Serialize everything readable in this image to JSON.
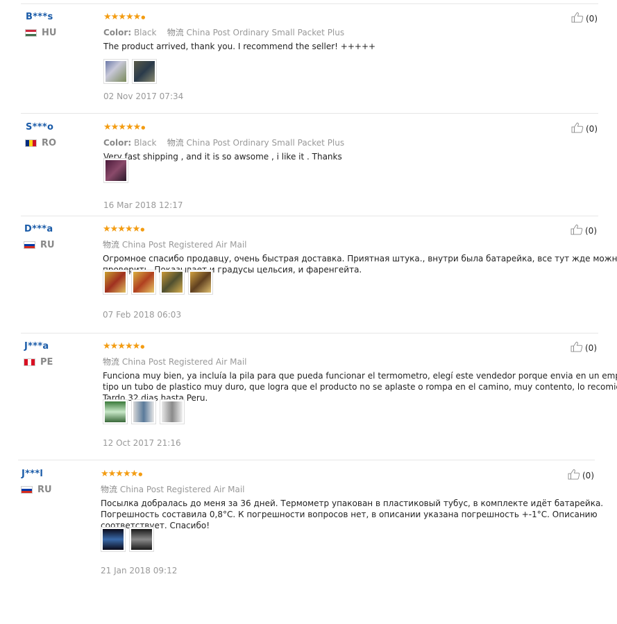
{
  "reviews": [
    {
      "name": "B***s",
      "country": "HU",
      "flag": [
        "#cd2a3e",
        "#ffffff",
        "#436f4d"
      ],
      "color_label": "Color:",
      "color_value": "Black",
      "shipping_label": "物流",
      "shipping_value": "China Post Ordinary Small Packet Plus",
      "text": [
        "The product arrived, thank you. I recommend the seller! +++++"
      ],
      "date": "02 Nov 2017 07:34",
      "likes": "(0)",
      "thumbs": [
        "linear-gradient(135deg,#6a78a8,#c8c8d8 40%,#7a8a5a)",
        "linear-gradient(135deg,#5a5a48,#2a3a4a 50%,#8a8a70)"
      ]
    },
    {
      "name": "S***o",
      "country": "RO",
      "flag": [
        "#002b7f",
        "#fcd116",
        "#ce1126"
      ],
      "color_label": "Color:",
      "color_value": "Black",
      "shipping_label": "物流",
      "shipping_value": "China Post Ordinary Small Packet Plus",
      "text": [
        "Very fast shipping , and it is so awsome , i like it . Thanks"
      ],
      "date": "16 Mar 2018 12:17",
      "likes": "(0)",
      "thumbs": [
        "linear-gradient(135deg,#4a1a3a,#8a4a6a 50%,#2a1a2a)"
      ]
    },
    {
      "name": "D***a",
      "country": "RU",
      "flag": [
        "#ffffff",
        "#0039a6",
        "#d52b1e"
      ],
      "color_label": "",
      "color_value": "",
      "shipping_label": "物流",
      "shipping_value": "China Post Registered Air Mail",
      "text": [
        "Огромное спасибо продавцу, очень быстрая доставка. Приятная штука., внутри была батарейка, все тут жде можно",
        "проверить. Показывает и градусы цельсия, и фаренгейта."
      ],
      "date": "07 Feb 2018 06:03",
      "likes": "(0)",
      "thumbs": [
        "linear-gradient(135deg,#c8a030,#a03020 50%,#e0c060)",
        "linear-gradient(135deg,#d8b040,#b04020 50%,#e8c868)",
        "linear-gradient(135deg,#c89838,#505030 50%,#d8b050)",
        "linear-gradient(135deg,#d0a040,#604020 50%,#e0c070)"
      ]
    },
    {
      "name": "J***a",
      "country": "PE",
      "flag": [
        "#d91023",
        "#ffffff",
        "#d91023"
      ],
      "color_label": "",
      "color_value": "",
      "shipping_label": "物流",
      "shipping_value": "China Post Registered Air Mail",
      "text": [
        "Funciona muy bien, ya incluía la pila para que pueda funcionar el termometro, elegí este vendedor porque envia en un empaque",
        "tipo un tubo de plastico muy duro, que logra que el producto no se aplaste o rompa en el camino, muy contento, lo recomiendo.",
        "Tardo 32 dias hasta Peru."
      ],
      "date": "12 Oct 2017 21:16",
      "likes": "(0)",
      "thumbs": [
        "linear-gradient(180deg,#3a7a3a,#c8e8c8 50%,#3a6a3a)",
        "linear-gradient(90deg,#d8d8d8,#5a7a9a 50%,#e8e8e8)",
        "linear-gradient(90deg,#e8e8e8,#8a8a8a 50%,#f0f0f0)"
      ]
    },
    {
      "name": "J***l",
      "country": "RU",
      "flag": [
        "#ffffff",
        "#0039a6",
        "#d52b1e"
      ],
      "color_label": "",
      "color_value": "",
      "shipping_label": "物流",
      "shipping_value": "China Post Registered Air Mail",
      "text": [
        "Посылка добралась до меня за 36 дней. Термометр упакован в пластиковый тубус, в комплекте идёт батарейка.",
        "Погрешность составила 0,8°C. К погрешности вопросов нет, в описании указана погрешность +-1°C. Описанию",
        "соответствует. Спасибо!"
      ],
      "date": "21 Jan 2018 09:12",
      "likes": "(0)",
      "thumbs": [
        "linear-gradient(180deg,#0a0a1a,#3a6aaa 50%,#0a0a1a)",
        "linear-gradient(180deg,#1a1a1a,#8a8a8a 50%,#1a1a1a)"
      ]
    }
  ]
}
